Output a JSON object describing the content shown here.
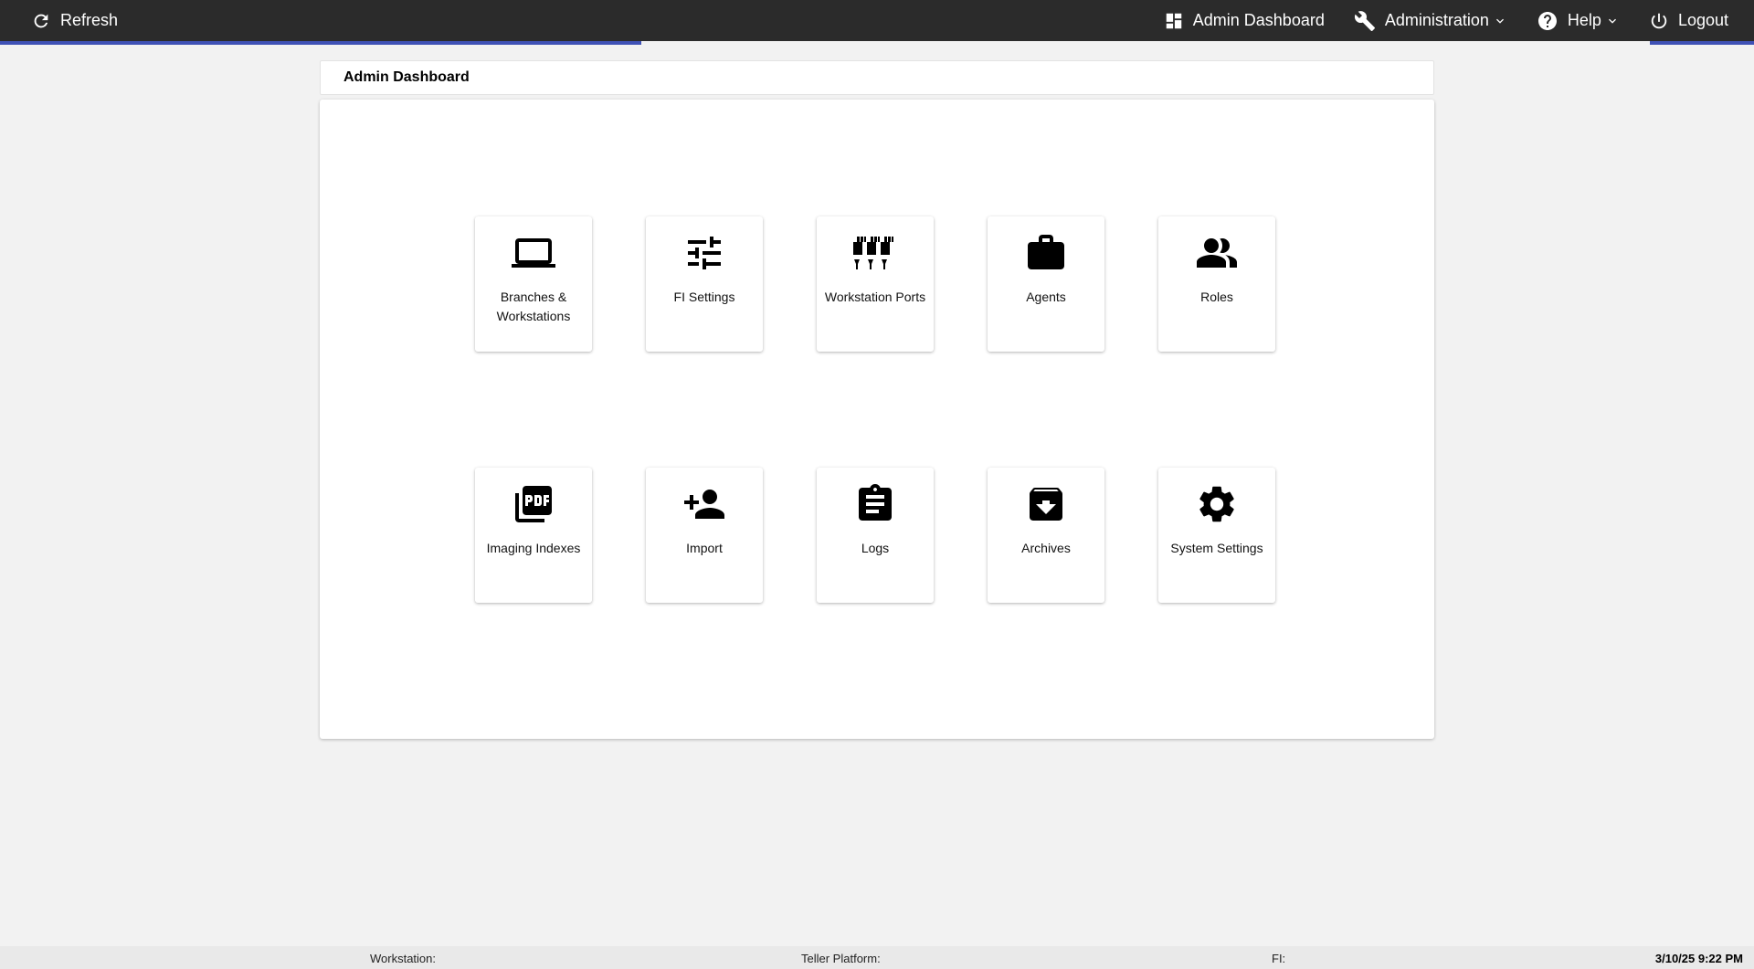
{
  "topbar": {
    "refresh_label": "Refresh",
    "admin_dashboard_label": "Admin Dashboard",
    "administration_label": "Administration",
    "help_label": "Help",
    "logout_label": "Logout",
    "accent_color": "#3f51b5"
  },
  "page": {
    "title": "Admin Dashboard"
  },
  "tiles": [
    {
      "label": "Branches & Workstations",
      "icon": "laptop-icon"
    },
    {
      "label": "FI Settings",
      "icon": "tune-icon"
    },
    {
      "label": "Workstation Ports",
      "icon": "ports-icon"
    },
    {
      "label": "Agents",
      "icon": "briefcase-icon"
    },
    {
      "label": "Roles",
      "icon": "people-icon"
    },
    {
      "label": "Imaging Indexes",
      "icon": "pdf-icon"
    },
    {
      "label": "Import",
      "icon": "person-add-icon"
    },
    {
      "label": "Logs",
      "icon": "clipboard-icon"
    },
    {
      "label": "Archives",
      "icon": "archive-icon"
    },
    {
      "label": "System Settings",
      "icon": "gear-icon"
    }
  ],
  "statusbar": {
    "workstation_label": "Workstation:",
    "teller_label": "Teller Platform:",
    "fi_label": "FI:",
    "datetime": "3/10/25 9:22 PM"
  }
}
